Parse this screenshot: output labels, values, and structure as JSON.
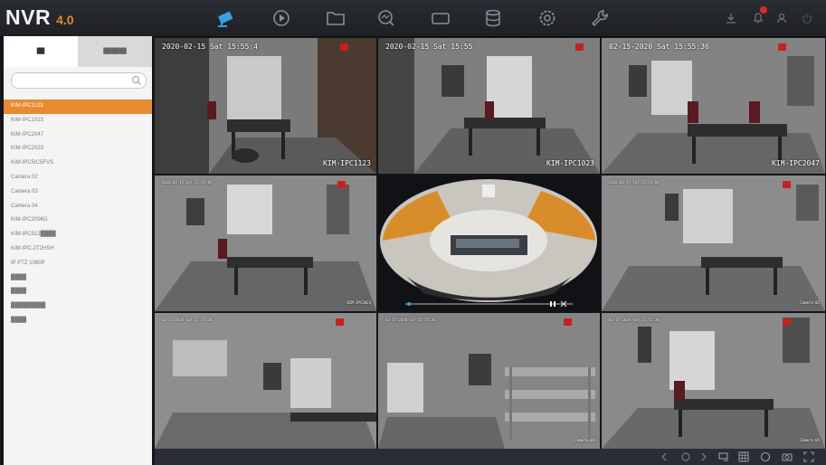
{
  "brand": {
    "name": "NVR",
    "version": "4.0",
    "accent": "#e28a2b"
  },
  "nav": [
    "live-view-icon",
    "playback-icon",
    "file-icon",
    "smart-search-icon",
    "display-icon",
    "storage-icon",
    "settings-icon",
    "maintenance-icon"
  ],
  "topright": [
    "download-icon",
    "alarm-bell-icon",
    "user-icon",
    "power-icon"
  ],
  "sidebar": {
    "tabs": [
      {
        "label": "██"
      },
      {
        "label": "██████"
      }
    ],
    "selected_color": "#e98a31",
    "cameras": [
      {
        "label": "KIM-IPC1123"
      },
      {
        "label": "KIM-IPC1023"
      },
      {
        "label": "KIM-IPC2047"
      },
      {
        "label": "KIM-IPC2023"
      },
      {
        "label": "KIM-IPC5IC5FVS"
      },
      {
        "label": "Camera 02"
      },
      {
        "label": "Camera 03"
      },
      {
        "label": "Camera 04"
      },
      {
        "label": "KIM-IPC2096G"
      },
      {
        "label": "KIM-IPC512████"
      },
      {
        "label": "KIM-IPC-2T2HSH"
      },
      {
        "label": "IP PTZ 1080P"
      },
      {
        "label": "████"
      },
      {
        "label": "████"
      },
      {
        "label": "█████████"
      },
      {
        "label": "████"
      }
    ]
  },
  "tiles": [
    {
      "osd": "2020-02-15 Sat 15:55:4",
      "name": "KIM-IPC1123"
    },
    {
      "osd": "2020-02-15 Sat 15:55",
      "name": "KIM-IPC1023"
    },
    {
      "osd": "02-15-2020 Sat 15:55:36",
      "name": "KIM-IPC2047"
    },
    {
      "osd": "2020-02-15 Sat 15:55:04",
      "name": "KIM-IPC2023"
    },
    {
      "osd": "",
      "name": ""
    },
    {
      "osd": "2020-02-15 Sat 15:55:04",
      "name": "Camera 02"
    },
    {
      "osd": "02-15-2020 Sat 15:55:36",
      "name": ""
    },
    {
      "osd": "02-15-2020 Sat 15:55:36",
      "name": "Camera 04"
    },
    {
      "osd": "02-15-2020 Sat 15:55:36",
      "name": "Camera 05"
    }
  ],
  "bottombar": [
    "prev-page-icon",
    "next-page-icon",
    "sequence-icon",
    "layout-icon",
    "fullscreen-icon",
    "snapshot-icon",
    "expand-icon"
  ]
}
